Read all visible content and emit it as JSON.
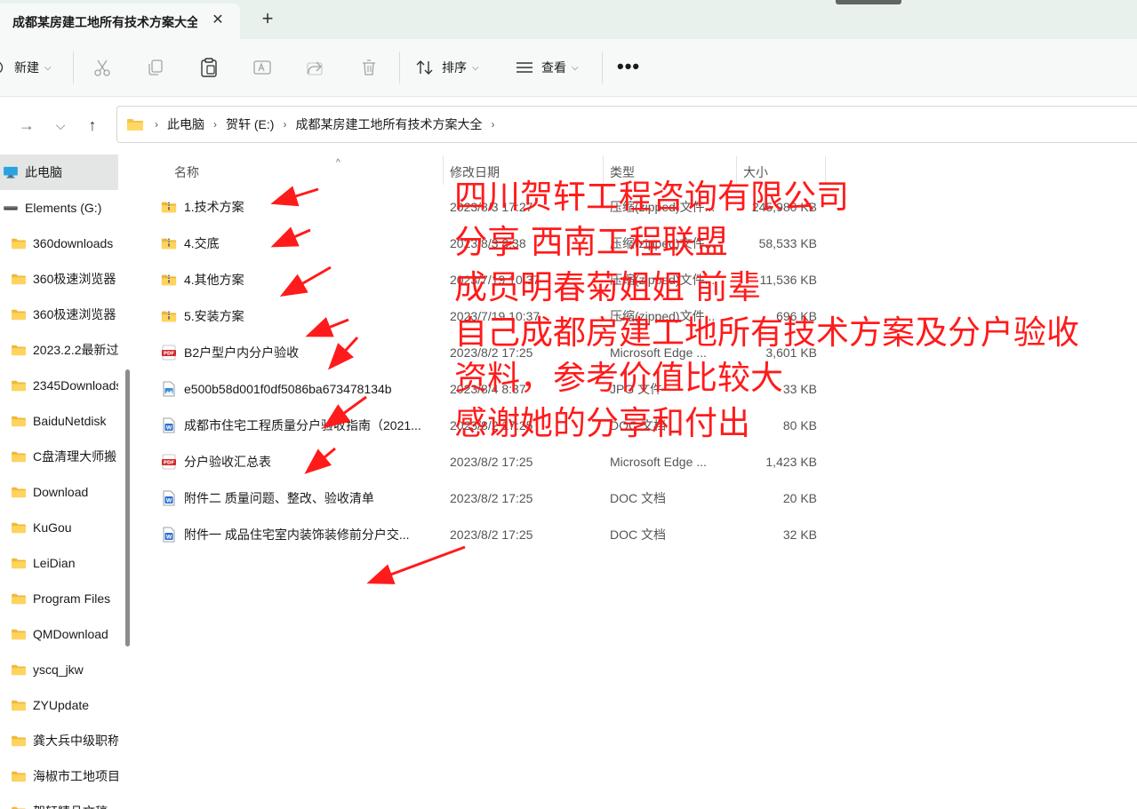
{
  "window": {
    "tab_title": "成都某房建工地所有技术方案大全",
    "close_glyph": "✕",
    "new_tab_glyph": "+"
  },
  "toolbar": {
    "new_label": "新建",
    "sort_label": "排序",
    "view_label": "查看",
    "more_glyph": "•••"
  },
  "address": {
    "crumbs": [
      "此电脑",
      "贺轩 (E:)",
      "成都某房建工地所有技术方案大全"
    ]
  },
  "sidebar": {
    "items": [
      {
        "label": "此电脑",
        "icon": "computer-icon",
        "selected": true
      },
      {
        "label": "Elements (G:)",
        "icon": "drive-icon"
      },
      {
        "label": "360downloads",
        "icon": "folder-icon"
      },
      {
        "label": "360极速浏览器",
        "icon": "folder-icon"
      },
      {
        "label": "360极速浏览器",
        "icon": "folder-icon"
      },
      {
        "label": "2023.2.2最新过",
        "icon": "folder-icon"
      },
      {
        "label": "2345Downloads",
        "icon": "folder-icon"
      },
      {
        "label": "BaiduNetdisk",
        "icon": "folder-icon"
      },
      {
        "label": "C盘清理大师搬",
        "icon": "folder-icon"
      },
      {
        "label": "Download",
        "icon": "folder-icon"
      },
      {
        "label": "KuGou",
        "icon": "folder-icon"
      },
      {
        "label": "LeiDian",
        "icon": "folder-icon"
      },
      {
        "label": "Program Files",
        "icon": "folder-icon"
      },
      {
        "label": "QMDownload",
        "icon": "folder-icon"
      },
      {
        "label": "yscq_jkw",
        "icon": "folder-icon"
      },
      {
        "label": "ZYUpdate",
        "icon": "folder-icon"
      },
      {
        "label": "龚大兵中级职称",
        "icon": "folder-icon"
      },
      {
        "label": "海椒市工地项目",
        "icon": "folder-icon"
      },
      {
        "label": "贺轩精品文稿",
        "icon": "folder-icon"
      }
    ]
  },
  "columns": {
    "name": "名称",
    "date": "修改日期",
    "type": "类型",
    "size": "大小",
    "sort_glyph": "^"
  },
  "files": [
    {
      "name": "1.技术方案",
      "date": "2023/8/3 17:27",
      "type": "压缩(zipped)文件...",
      "size": "245,980 KB",
      "icon": "zip-folder-icon"
    },
    {
      "name": "4.交底",
      "date": "2023/8/3 8:38",
      "type": "压缩(zipped)文件...",
      "size": "58,533 KB",
      "icon": "zip-folder-icon"
    },
    {
      "name": "4.其他方案",
      "date": "2023/7/19 10:37",
      "type": "压缩(zipped)文件...",
      "size": "11,536 KB",
      "icon": "zip-folder-icon"
    },
    {
      "name": "5.安装方案",
      "date": "2023/7/19 10:37",
      "type": "压缩(zipped)文件...",
      "size": "696 KB",
      "icon": "zip-folder-icon"
    },
    {
      "name": "B2户型户内分户验收",
      "date": "2023/8/2 17:25",
      "type": "Microsoft Edge ...",
      "size": "3,601 KB",
      "icon": "pdf-icon"
    },
    {
      "name": "e500b58d001f0df5086ba673478134b",
      "date": "2023/8/4 8:37",
      "type": "JPG 文件",
      "size": "33 KB",
      "icon": "image-icon"
    },
    {
      "name": "成都市住宅工程质量分户验收指南（2021...",
      "date": "2023/8/2 17:25",
      "type": "DOC 文档",
      "size": "80 KB",
      "icon": "word-icon"
    },
    {
      "name": "分户验收汇总表",
      "date": "2023/8/2 17:25",
      "type": "Microsoft Edge ...",
      "size": "1,423 KB",
      "icon": "pdf-icon"
    },
    {
      "name": "附件二 质量问题、整改、验收清单",
      "date": "2023/8/2 17:25",
      "type": "DOC 文档",
      "size": "20 KB",
      "icon": "word-icon"
    },
    {
      "name": "附件一 成品住宅室内装饰装修前分户交...",
      "date": "2023/8/2 17:25",
      "type": "DOC 文档",
      "size": "32 KB",
      "icon": "word-icon"
    }
  ],
  "annotation": {
    "color": "#ff1b1b",
    "lines": [
      "四川贺轩工程咨询有限公司",
      "分享 西南工程联盟",
      "成员明春菊姐姐 前辈",
      "自己成都房建工地所有技术方案及分户验收",
      "资料，参考价值比较大",
      "感谢她的分享和付出"
    ]
  }
}
